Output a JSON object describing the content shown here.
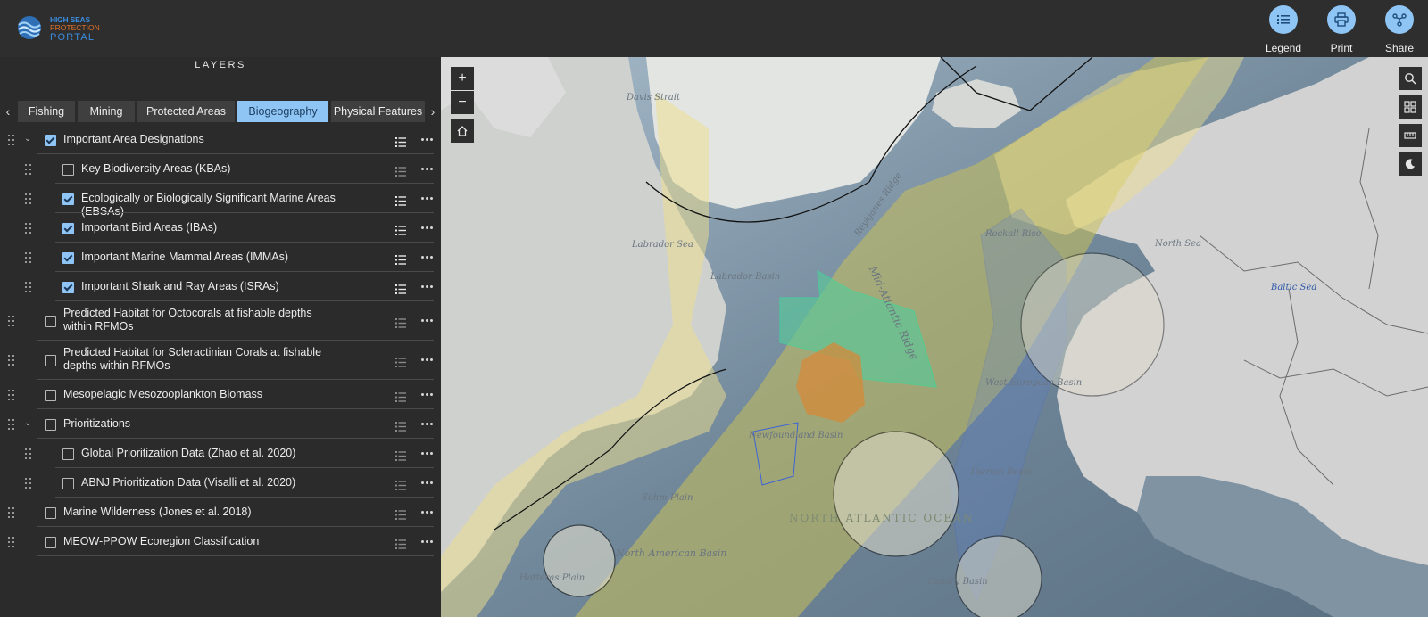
{
  "app": {
    "logo_line1": "HIGH SEAS",
    "logo_line2": "PROTECTION",
    "logo_line3": "PORTAL"
  },
  "toolbar": {
    "legend_label": "Legend",
    "print_label": "Print",
    "share_label": "Share"
  },
  "panel": {
    "title": "LAYERS",
    "tabs": [
      {
        "label": "Fishing",
        "active": false
      },
      {
        "label": "Mining",
        "active": false
      },
      {
        "label": "Protected Areas",
        "active": false
      },
      {
        "label": "Biogeography",
        "active": true
      },
      {
        "label": "Physical Features",
        "active": false
      }
    ],
    "layers": [
      {
        "label": "Important Area Designations",
        "checked": true,
        "expanded": true,
        "level": 0
      },
      {
        "label": "Key Biodiversity Areas (KBAs)",
        "checked": false,
        "level": 1
      },
      {
        "label": "Ecologically or Biologically Significant Marine Areas (EBSAs)",
        "checked": true,
        "level": 1
      },
      {
        "label": "Important Bird Areas (IBAs)",
        "checked": true,
        "level": 1
      },
      {
        "label": "Important Marine Mammal Areas (IMMAs)",
        "checked": true,
        "level": 1
      },
      {
        "label": "Important Shark and Ray Areas (ISRAs)",
        "checked": true,
        "level": 1
      },
      {
        "label": "Predicted Habitat for Octocorals at fishable depths within RFMOs",
        "checked": false,
        "level": 0
      },
      {
        "label": "Predicted Habitat for Scleractinian Corals at fishable depths within RFMOs",
        "checked": false,
        "level": 0
      },
      {
        "label": "Mesopelagic Mesozooplankton Biomass",
        "checked": false,
        "level": 0
      },
      {
        "label": "Prioritizations",
        "checked": false,
        "expanded": true,
        "level": 0
      },
      {
        "label": "Global Prioritization Data (Zhao et al. 2020)",
        "checked": false,
        "level": 1
      },
      {
        "label": "ABNJ Prioritization Data (Visalli et al. 2020)",
        "checked": false,
        "level": 1
      },
      {
        "label": "Marine Wilderness (Jones et al. 2018)",
        "checked": false,
        "level": 0
      },
      {
        "label": "MEOW-PPOW Ecoregion Classification",
        "checked": false,
        "level": 0
      }
    ]
  },
  "map": {
    "zoom_in": "+",
    "zoom_out": "−",
    "labels": [
      {
        "text": "Davis Strait"
      },
      {
        "text": "Labrador Sea"
      },
      {
        "text": "Labrador Basin"
      },
      {
        "text": "Reykjanes Ridge"
      },
      {
        "text": "Mid-Atlantic Ridge"
      },
      {
        "text": "Rockall Rise"
      },
      {
        "text": "North Sea"
      },
      {
        "text": "Baltic Sea"
      },
      {
        "text": "Newfoundland Basin"
      },
      {
        "text": "West European Basin"
      },
      {
        "text": "Iberian Basin"
      },
      {
        "text": "Sohm Plain"
      },
      {
        "text": "NORTH ATLANTIC OCEAN"
      },
      {
        "text": "North American Basin"
      },
      {
        "text": "Hatteras Plain"
      },
      {
        "text": "Canary Basin"
      }
    ]
  }
}
